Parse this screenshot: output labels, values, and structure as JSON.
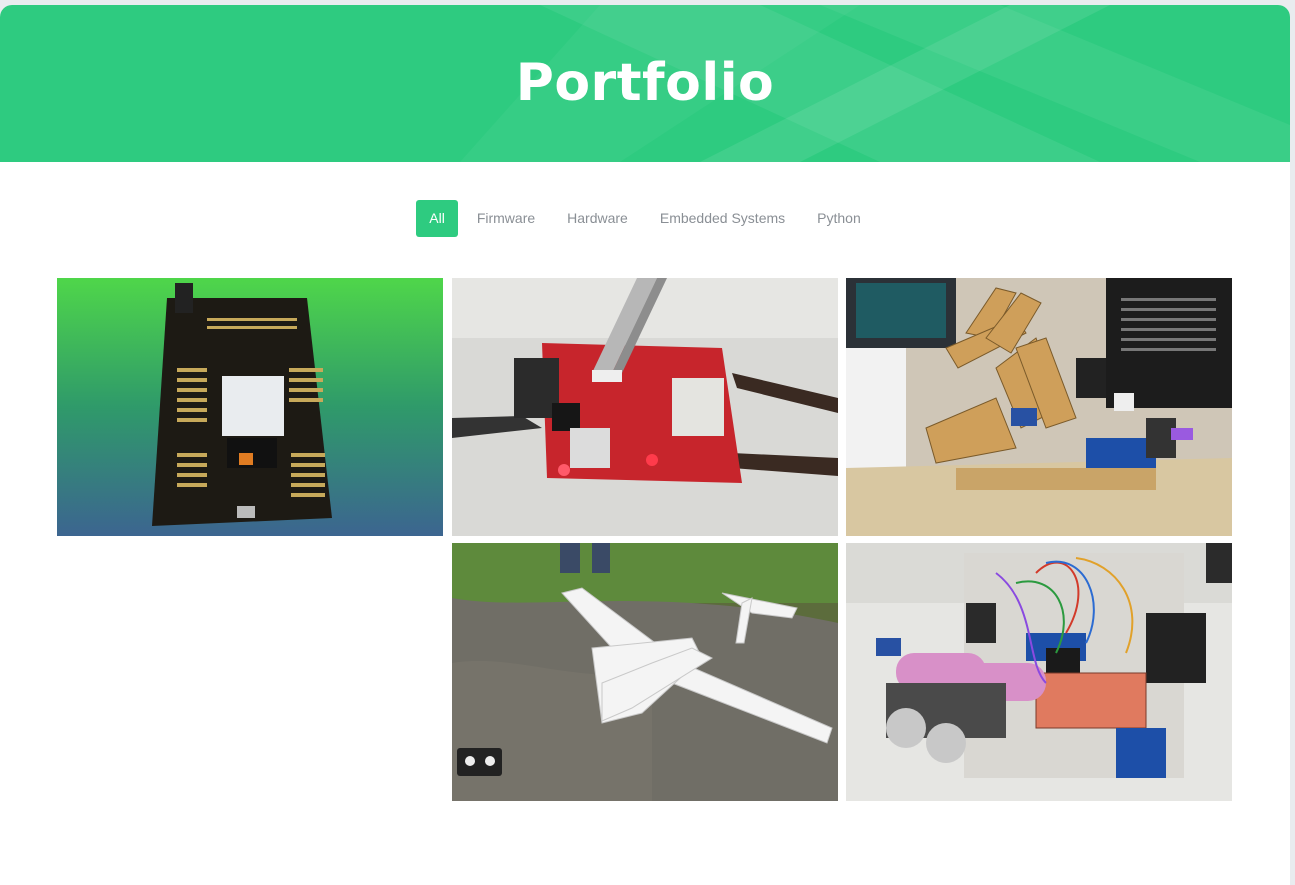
{
  "header": {
    "title": "Portfolio"
  },
  "filters": [
    {
      "label": "All",
      "active": true
    },
    {
      "label": "Firmware",
      "active": false
    },
    {
      "label": "Hardware",
      "active": false
    },
    {
      "label": "Embedded Systems",
      "active": false
    },
    {
      "label": "Python",
      "active": false
    }
  ],
  "portfolio_items": [
    {
      "name": "esp32-pcb-board"
    },
    {
      "name": "red-iot-board"
    },
    {
      "name": "robotic-arm"
    },
    {
      "name": "rc-airplane"
    },
    {
      "name": "robot-car"
    }
  ],
  "colors": {
    "accent": "#2ecb80",
    "filter_text": "#8a8f95",
    "background": "#ffffff"
  }
}
